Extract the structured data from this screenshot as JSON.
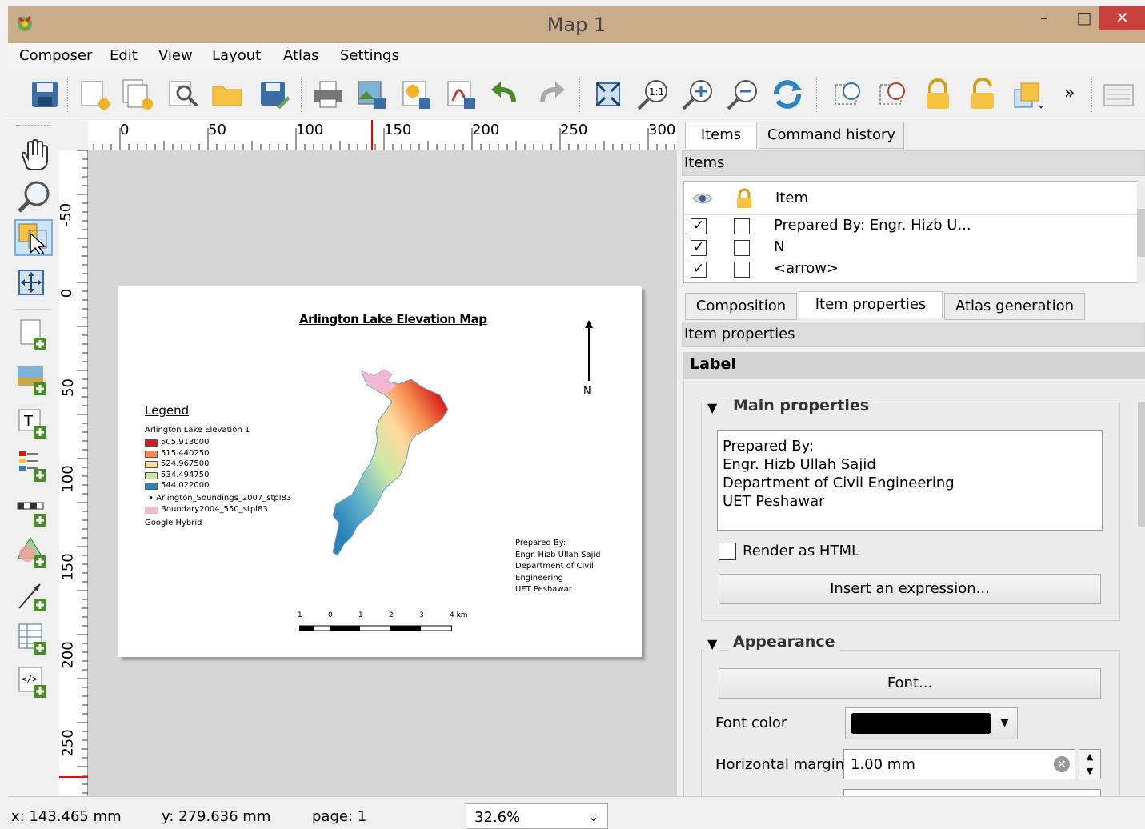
{
  "window": {
    "title": "Map 1",
    "minimize": "–",
    "maximize": "□",
    "close": "✕"
  },
  "menu": [
    "Composer",
    "Edit",
    "View",
    "Layout",
    "Atlas",
    "Settings"
  ],
  "toolbar": {
    "overflow": "»"
  },
  "ruler": {
    "top_ticks": [
      "0",
      "50",
      "100",
      "150",
      "200",
      "250",
      "300"
    ],
    "left_ticks": [
      "-50",
      "0",
      "50",
      "100",
      "150",
      "200",
      "250"
    ]
  },
  "map": {
    "title": "Arlington Lake Elevation Map",
    "north_label": "N",
    "legend_title": "Legend",
    "legend_layer": "Arlington Lake Elevation 1",
    "legend_items": [
      {
        "label": "505.913000",
        "color": "#d7191c"
      },
      {
        "label": "515.440250",
        "color": "#f48d4d"
      },
      {
        "label": "524.967500",
        "color": "#fed99c"
      },
      {
        "label": "534.494750",
        "color": "#cde8a6"
      },
      {
        "label": "544.022000",
        "color": "#2b83ba"
      }
    ],
    "legend_points": "Arlington_Soundings_2007_stpl83",
    "legend_boundary": "Boundary2004_550_stpl83",
    "boundary_color": "#f4b8d4",
    "legend_basemap": "Google Hybrid",
    "prepared_lines": [
      "Prepared By:",
      "Engr. Hizb Ullah Sajid",
      "Department of Civil",
      "Engineering",
      "UET Peshawar"
    ],
    "scale_labels": [
      "1",
      "0",
      "1",
      "2",
      "3",
      "4 km"
    ]
  },
  "right_panel": {
    "top_tabs": [
      "Items",
      "Command history"
    ],
    "items_header": "Items",
    "items_column": "Item",
    "items": [
      {
        "visible": "✓",
        "locked": "",
        "label": "Prepared By: Engr. Hizb U..."
      },
      {
        "visible": "✓",
        "locked": "",
        "label": "N"
      },
      {
        "visible": "✓",
        "locked": "",
        "label": "<arrow>"
      }
    ],
    "bottom_tabs": [
      "Composition",
      "Item properties",
      "Atlas generation"
    ],
    "props_header": "Item properties",
    "label_header": "Label",
    "main_section": "Main properties",
    "label_text": [
      "Prepared By:",
      "Engr. Hizb Ullah Sajid",
      "Department of Civil Engineering",
      "UET Peshawar"
    ],
    "render_html": "Render as HTML",
    "insert_expression": "Insert an expression...",
    "appearance_section": "Appearance",
    "font_button": "Font...",
    "font_color_label": "Font color",
    "font_color_value": "#000000",
    "hmargin_label": "Horizontal margin",
    "hmargin_value": "1.00 mm"
  },
  "status": {
    "x": "x: 143.465 mm",
    "y": "y: 279.636 mm",
    "page": "page: 1",
    "zoom": "32.6%"
  }
}
